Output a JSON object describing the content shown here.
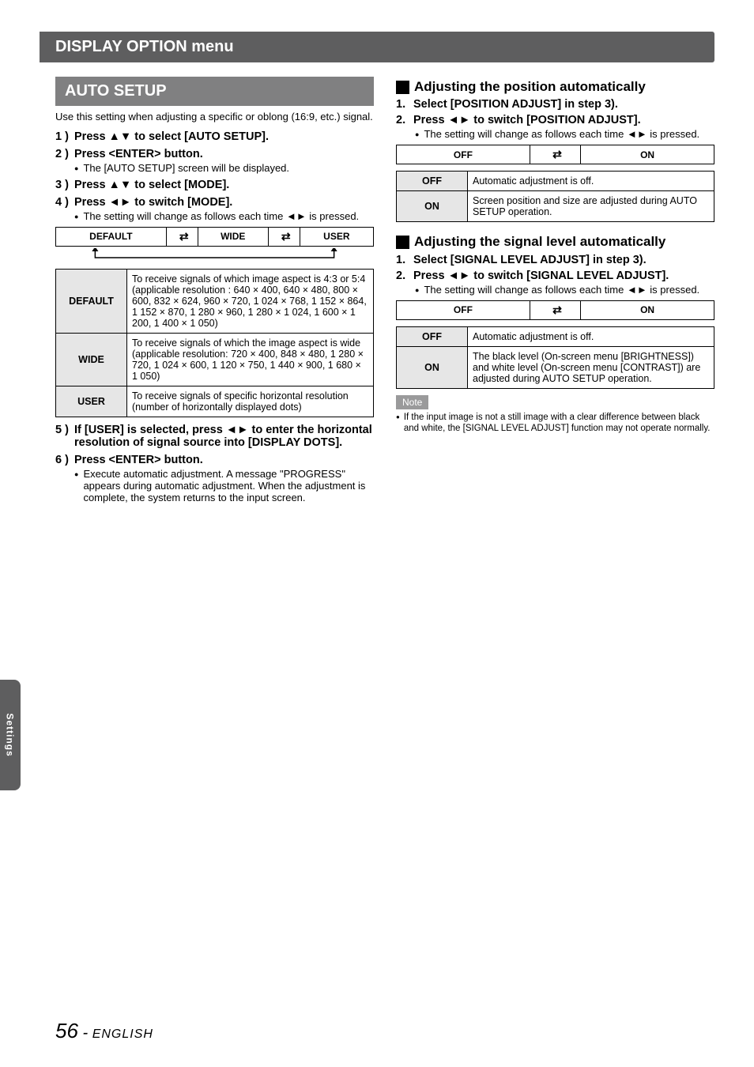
{
  "title": "DISPLAY OPTION menu",
  "sideTab": "Settings",
  "footer": {
    "page": "56",
    "sep": " - ",
    "lang": "ENGLISH"
  },
  "left": {
    "sectionHead": "AUTO SETUP",
    "intro": "Use this setting when adjusting a specific or oblong (16:9, etc.) signal.",
    "s1": "Press ▲▼ to select [AUTO SETUP].",
    "s2": "Press <ENTER> button.",
    "s2b": "The [AUTO SETUP] screen will be displayed.",
    "s3": "Press ▲▼ to select [MODE].",
    "s4": "Press ◄► to switch [MODE].",
    "s4b": "The setting will change as follows each time ◄► is pressed.",
    "flow": {
      "a": "DEFAULT",
      "b": "WIDE",
      "c": "USER"
    },
    "tbl": [
      {
        "k": "DEFAULT",
        "v": "To receive signals of which image aspect is 4:3 or 5:4\n(applicable resolution : 640 × 400, 640 × 480, 800 × 600, 832 × 624, 960 × 720, 1 024 × 768, 1 152 × 864, 1 152 × 870, 1 280 × 960, 1 280 × 1 024, 1 600 × 1 200, 1 400 × 1 050)"
      },
      {
        "k": "WIDE",
        "v": "To receive signals of which the image aspect is wide\n(applicable resolution: 720 × 400, 848 × 480, 1 280 × 720, 1 024 × 600, 1 120 × 750, 1 440 × 900, 1 680 × 1 050)"
      },
      {
        "k": "USER",
        "v": "To receive signals of specific horizontal resolution (number of horizontally displayed dots)"
      }
    ],
    "s5": "If [USER] is selected, press ◄► to enter the horizontal resolution of signal source into [DISPLAY DOTS].",
    "s6": "Press <ENTER> button.",
    "s6b": "Execute automatic adjustment. A message \"PROGRESS\" appears during automatic adjustment. When the adjustment is complete, the system returns to the input screen."
  },
  "right": {
    "h1": "Adjusting the position automatically",
    "a1": "Select [POSITION ADJUST] in step 3).",
    "a2": "Press ◄► to switch [POSITION ADJUST].",
    "a2b": "The setting will change as follows each time ◄► is pressed.",
    "flow1": {
      "a": "OFF",
      "b": "ON"
    },
    "tbl1": [
      {
        "k": "OFF",
        "v": "Automatic adjustment is off."
      },
      {
        "k": "ON",
        "v": "Screen position and size are adjusted during AUTO SETUP operation."
      }
    ],
    "h2": "Adjusting the signal level automatically",
    "b1": "Select [SIGNAL LEVEL ADJUST] in step 3).",
    "b2": "Press ◄► to switch [SIGNAL LEVEL ADJUST].",
    "b2b": "The setting will change as follows each time ◄► is pressed.",
    "flow2": {
      "a": "OFF",
      "b": "ON"
    },
    "tbl2": [
      {
        "k": "OFF",
        "v": "Automatic adjustment is off."
      },
      {
        "k": "ON",
        "v": "The black level (On-screen menu [BRIGHTNESS]) and white level (On-screen menu [CONTRAST]) are adjusted during AUTO SETUP operation."
      }
    ],
    "noteLabel": "Note",
    "note": "If the input image is not a still image with a clear difference between black and white, the [SIGNAL LEVEL ADJUST] function may not operate normally."
  }
}
